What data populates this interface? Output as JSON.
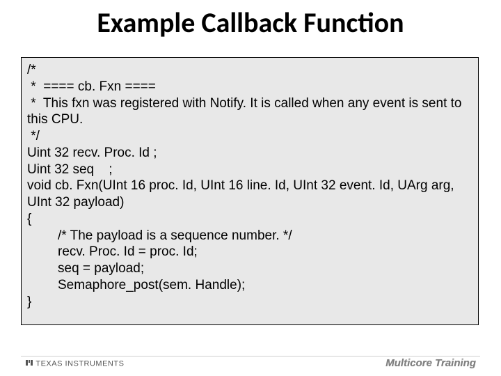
{
  "title": "Example Callback Function",
  "code": {
    "l0": "/*",
    "l1": " *  ==== cb. Fxn ====",
    "l2": " *  This fxn was registered with Notify. It is called when any event is sent to this CPU.",
    "l3": " */",
    "l4": "Uint 32 recv. Proc. Id ;",
    "l5": "Uint 32 seq    ;",
    "l6": "void cb. Fxn(UInt 16 proc. Id, UInt 16 line. Id, UInt 32 event. Id, UArg arg, UInt 32 payload)",
    "l7": "{",
    "l8": "/* The payload is a sequence number. */",
    "l9": "recv. Proc. Id = proc. Id;",
    "l10": "seq = payload;",
    "l11": "Semaphore_post(sem. Handle);",
    "l12": "}"
  },
  "footer": {
    "left_brand": "TEXAS INSTRUMENTS",
    "right_text": "Multicore Training"
  }
}
